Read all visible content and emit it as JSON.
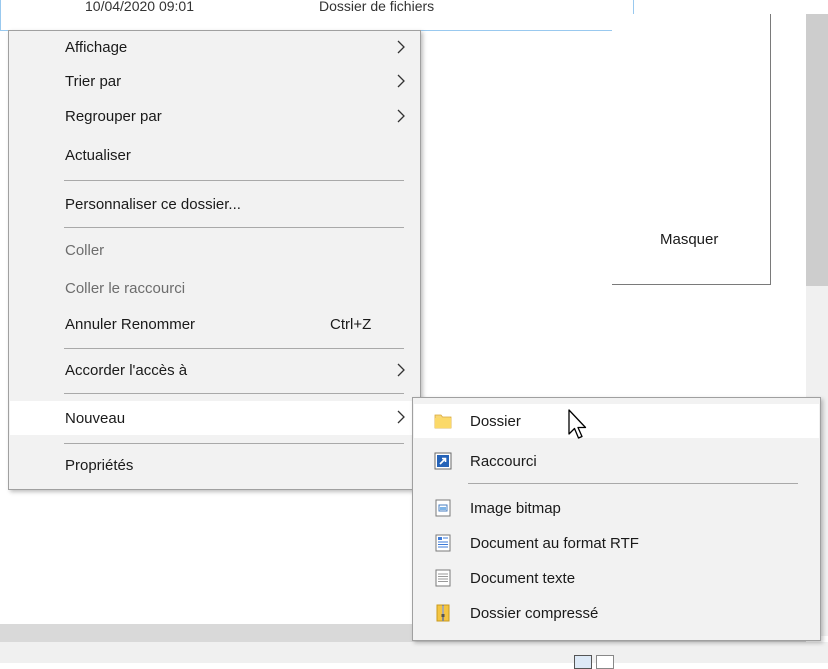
{
  "background": {
    "row": {
      "date": "10/04/2020 09:01",
      "type": "Dossier de fichiers"
    },
    "pane_label": "Masquer"
  },
  "context_menu": {
    "items": [
      {
        "label": "Affichage",
        "submenu": true
      },
      {
        "label": "Trier par",
        "submenu": true
      },
      {
        "label": "Regrouper par",
        "submenu": true
      },
      {
        "label": "Actualiser"
      },
      {
        "label": "Personnaliser ce dossier..."
      },
      {
        "label": "Coller",
        "disabled": true
      },
      {
        "label": "Coller le raccourci",
        "disabled": true
      },
      {
        "label": "Annuler Renommer",
        "shortcut": "Ctrl+Z"
      },
      {
        "label": "Accorder l'accès à",
        "submenu": true
      },
      {
        "label": "Nouveau",
        "submenu": true,
        "highlighted": true
      },
      {
        "label": "Propriétés"
      }
    ]
  },
  "submenu_nouveau": {
    "items": [
      {
        "label": "Dossier",
        "icon": "folder-icon",
        "highlighted": true
      },
      {
        "label": "Raccourci",
        "icon": "shortcut-icon"
      },
      {
        "label": "Image bitmap",
        "icon": "bitmap-icon"
      },
      {
        "label": "Document au format RTF",
        "icon": "rtf-document-icon"
      },
      {
        "label": "Document texte",
        "icon": "text-document-icon"
      },
      {
        "label": "Dossier compressé",
        "icon": "zip-folder-icon"
      }
    ]
  },
  "colors": {
    "menu_bg": "#f2f2f2",
    "highlight_bg": "#ffffff",
    "folder": "#f8d775",
    "disabled_text": "#6d6d6d"
  }
}
